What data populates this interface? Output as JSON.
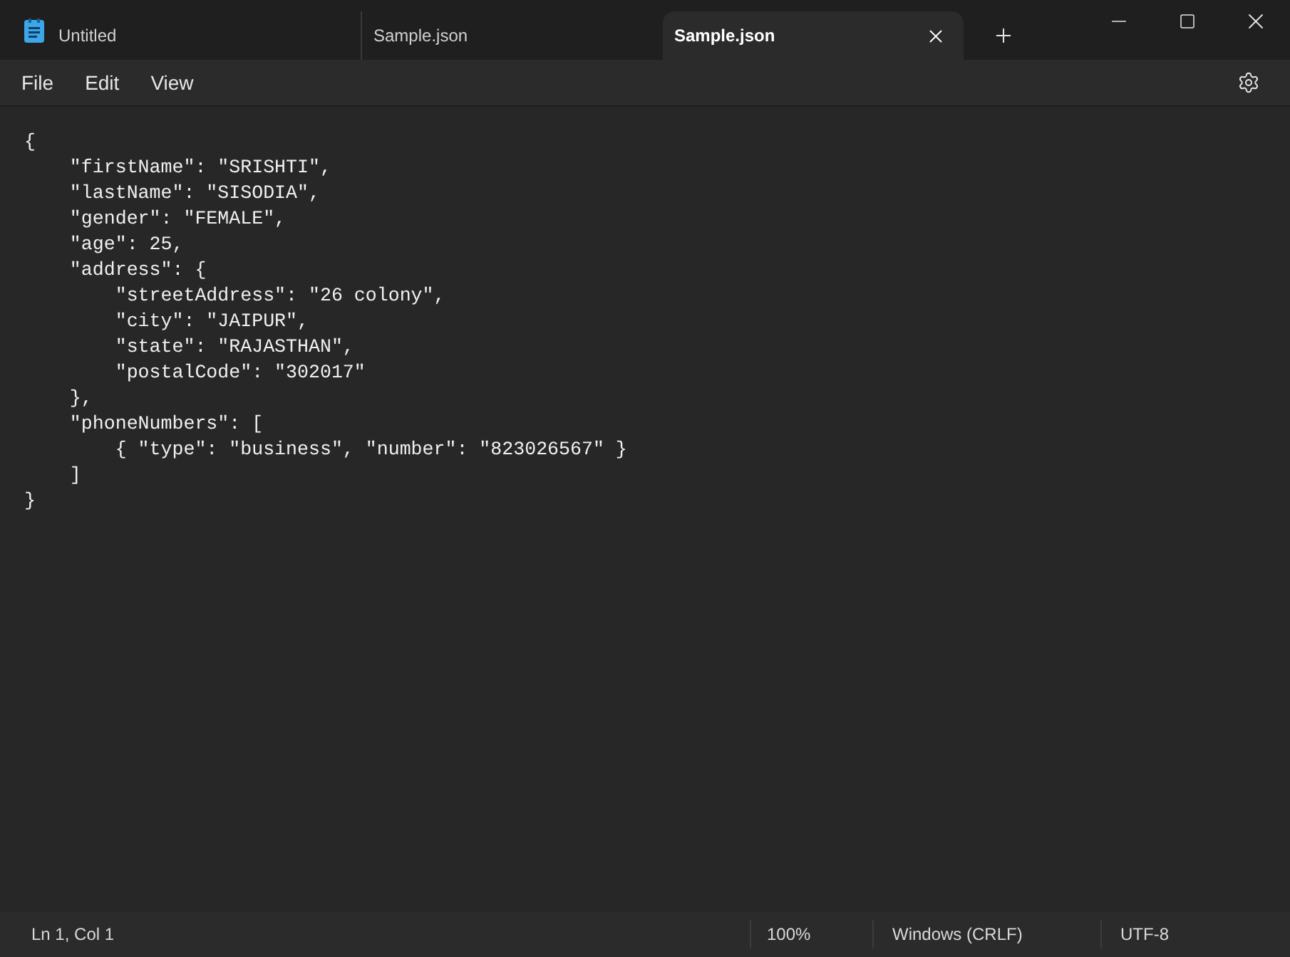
{
  "tabs": [
    {
      "label": "Untitled",
      "selected": false
    },
    {
      "label": "Sample.json",
      "selected": false
    },
    {
      "label": "Sample.json",
      "selected": true
    }
  ],
  "menu": [
    "File",
    "Edit",
    "View"
  ],
  "editor": {
    "lines": [
      "{",
      "    \"firstName\": \"SRISHTI\",",
      "    \"lastName\": \"SISODIA\",",
      "    \"gender\": \"FEMALE\",",
      "    \"age\": 25,",
      "    \"address\": {",
      "        \"streetAddress\": \"26 colony\",",
      "        \"city\": \"JAIPUR\",",
      "        \"state\": \"RAJASTHAN\",",
      "        \"postalCode\": \"302017\"",
      "    },",
      "    \"phoneNumbers\": [",
      "        { \"type\": \"business\", \"number\": \"823026567\" }",
      "    ]",
      "}"
    ]
  },
  "status_bar": {
    "position": "Ln 1, Col 1",
    "zoom": "100%",
    "line_ending": "Windows (CRLF)",
    "encoding": "UTF-8"
  }
}
